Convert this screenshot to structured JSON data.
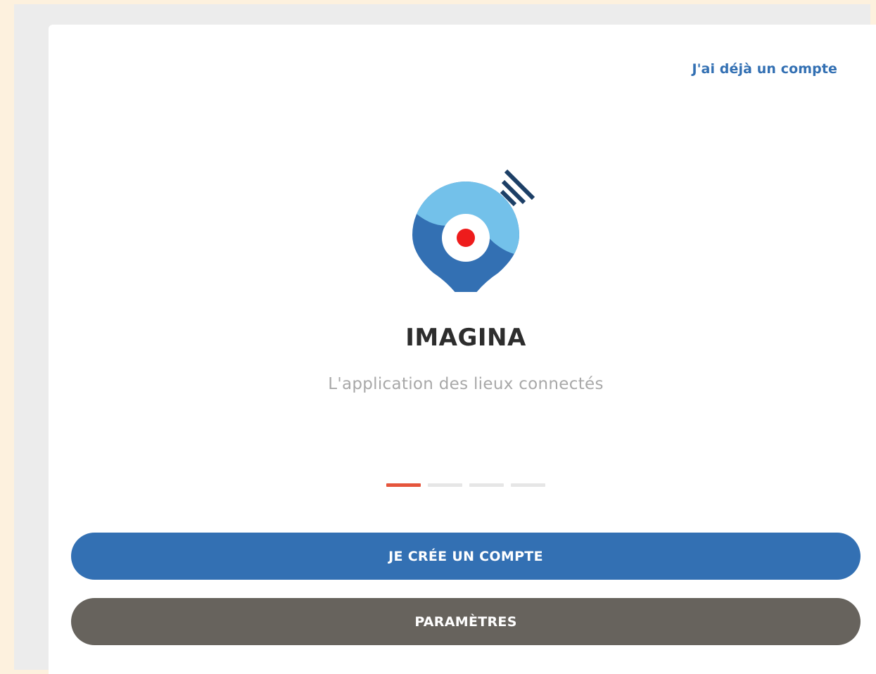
{
  "header": {
    "login_link": "J'ai déjà un compte"
  },
  "brand": {
    "logo_icon": "location-pin-logo-icon",
    "name": "IMAGINA",
    "tagline": "L'application des lieux connectés"
  },
  "onboarding": {
    "pages": 4,
    "current_page": 1
  },
  "actions": {
    "create_account": "JE CRÉE UN COMPTE",
    "settings": "PARAMÈTRES"
  },
  "colors": {
    "primary": "#3370b3",
    "secondary": "#67635d",
    "accent": "#e5553c",
    "logo_light": "#73c1ea",
    "logo_dark": "#3370b3",
    "logo_dot": "#ee1c1c",
    "logo_waves": "#1c3f66"
  }
}
